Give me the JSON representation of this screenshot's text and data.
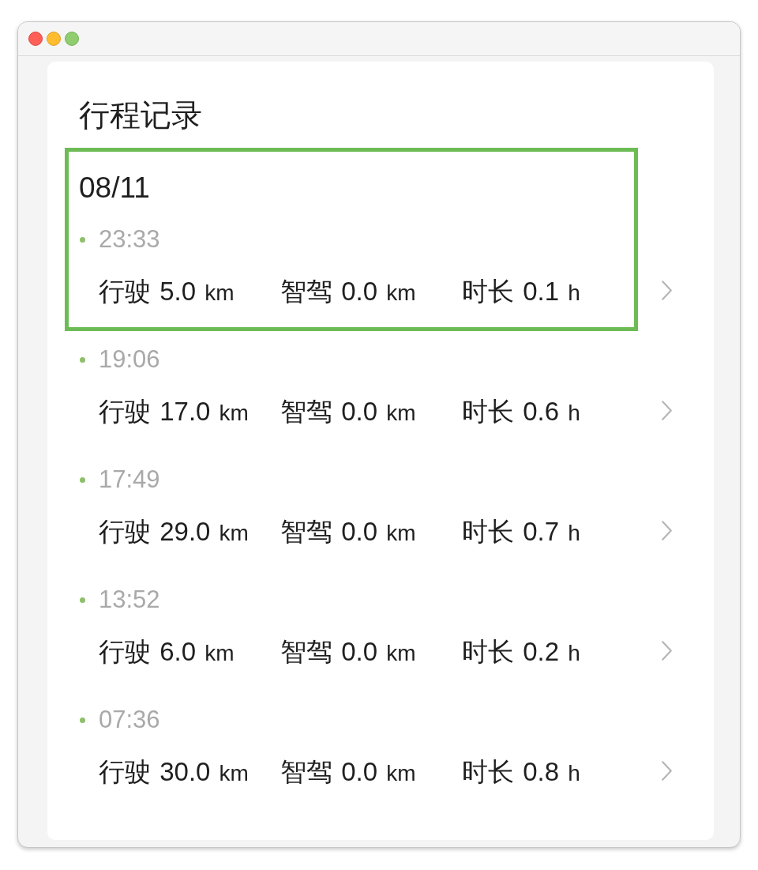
{
  "page": {
    "title": "行程记录"
  },
  "day": {
    "date": "08/11",
    "trips": [
      {
        "time": "23:33",
        "highlighted": true,
        "stats": [
          {
            "label": "行驶",
            "value": "5.0",
            "unit": "km"
          },
          {
            "label": "智驾",
            "value": "0.0",
            "unit": "km"
          },
          {
            "label": "时长",
            "value": "0.1",
            "unit": "h"
          }
        ]
      },
      {
        "time": "19:06",
        "highlighted": false,
        "stats": [
          {
            "label": "行驶",
            "value": "17.0",
            "unit": "km"
          },
          {
            "label": "智驾",
            "value": "0.0",
            "unit": "km"
          },
          {
            "label": "时长",
            "value": "0.6",
            "unit": "h"
          }
        ]
      },
      {
        "time": "17:49",
        "highlighted": false,
        "stats": [
          {
            "label": "行驶",
            "value": "29.0",
            "unit": "km"
          },
          {
            "label": "智驾",
            "value": "0.0",
            "unit": "km"
          },
          {
            "label": "时长",
            "value": "0.7",
            "unit": "h"
          }
        ]
      },
      {
        "time": "13:52",
        "highlighted": false,
        "stats": [
          {
            "label": "行驶",
            "value": "6.0",
            "unit": "km"
          },
          {
            "label": "智驾",
            "value": "0.0",
            "unit": "km"
          },
          {
            "label": "时长",
            "value": "0.2",
            "unit": "h"
          }
        ]
      },
      {
        "time": "07:36",
        "highlighted": false,
        "stats": [
          {
            "label": "行驶",
            "value": "30.0",
            "unit": "km"
          },
          {
            "label": "智驾",
            "value": "0.0",
            "unit": "km"
          },
          {
            "label": "时长",
            "value": "0.8",
            "unit": "h"
          }
        ]
      }
    ]
  }
}
